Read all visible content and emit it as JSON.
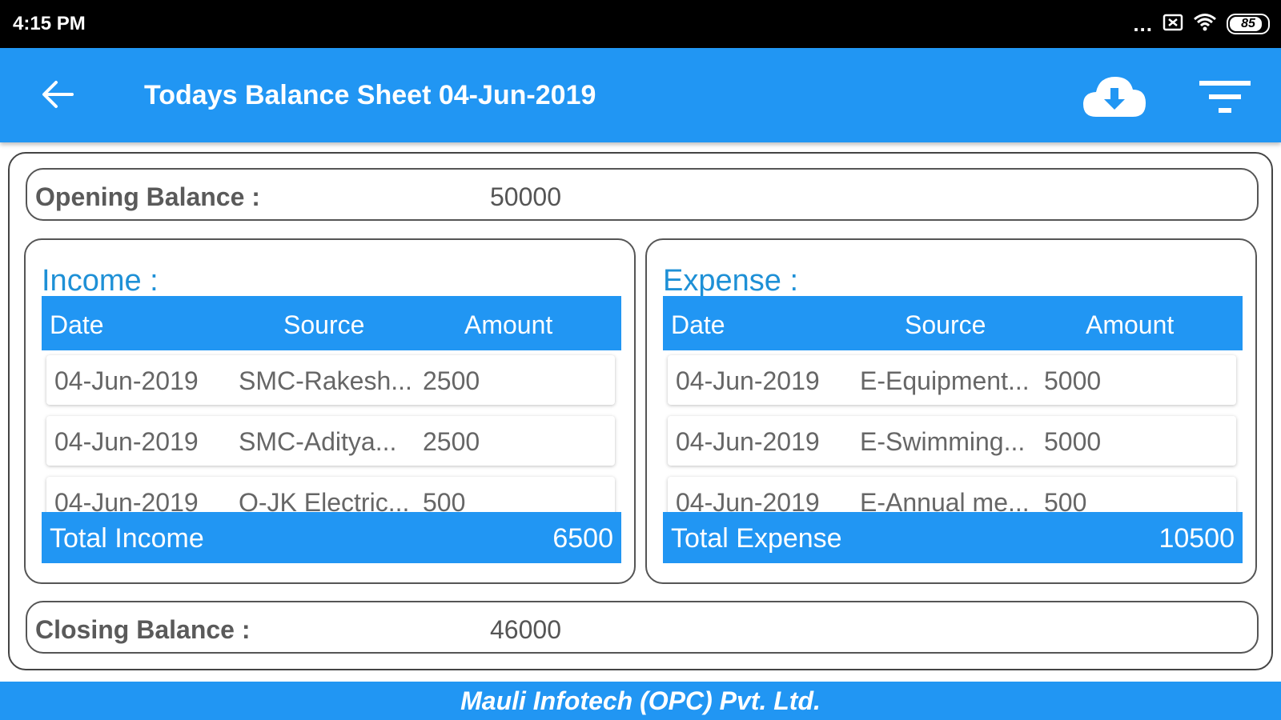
{
  "status_bar": {
    "time": "4:15 PM",
    "overflow_dots": "...",
    "battery_level": "85"
  },
  "app_bar": {
    "title": "Todays Balance Sheet 04-Jun-2019",
    "back_icon": "arrow-left-icon",
    "download_icon": "cloud-download-icon",
    "filter_icon": "filter-icon",
    "color": "#2196f3"
  },
  "opening": {
    "label": "Opening Balance :",
    "value": "50000"
  },
  "income": {
    "title": "Income :",
    "columns": [
      "Date",
      "Source",
      "Amount"
    ],
    "rows": [
      {
        "date": "04-Jun-2019",
        "source": "SMC-Rakesh...",
        "amount": "2500"
      },
      {
        "date": "04-Jun-2019",
        "source": "SMC-Aditya...",
        "amount": "2500"
      },
      {
        "date": "04-Jun-2019",
        "source": "O-JK Electric...",
        "amount": "500"
      }
    ],
    "total_label": "Total Income",
    "total_value": "6500"
  },
  "expense": {
    "title": "Expense :",
    "columns": [
      "Date",
      "Source",
      "Amount"
    ],
    "rows": [
      {
        "date": "04-Jun-2019",
        "source": "E-Equipment...",
        "amount": "5000"
      },
      {
        "date": "04-Jun-2019",
        "source": "E-Swimming...",
        "amount": "5000"
      },
      {
        "date": "04-Jun-2019",
        "source": "E-Annual me...",
        "amount": "500"
      }
    ],
    "total_label": "Total Expense",
    "total_value": "10500"
  },
  "closing": {
    "label": "Closing Balance :",
    "value": "46000"
  },
  "footer": {
    "text": "Mauli Infotech (OPC) Pvt. Ltd."
  }
}
